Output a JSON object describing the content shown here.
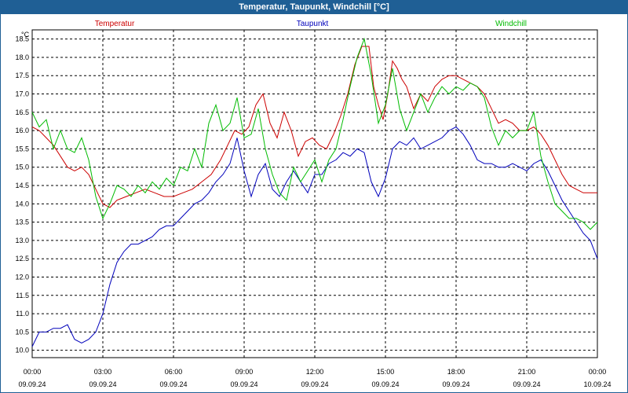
{
  "window": {
    "title": "Temperatur, Taupunkt, Windchill [°C]"
  },
  "chart_data": {
    "type": "line",
    "title": "Temperatur, Taupunkt, Windchill [°C]",
    "ylabel": "°C",
    "xlabel": "",
    "ylim": [
      9.8,
      18.75
    ],
    "xlim": [
      0,
      24
    ],
    "grid": true,
    "legend_position": "top",
    "y_ticks": [
      "10.0",
      "10.5",
      "11.0",
      "11.5",
      "12.0",
      "12.5",
      "13.0",
      "13.5",
      "14.0",
      "14.5",
      "15.0",
      "15.5",
      "16.0",
      "16.5",
      "17.0",
      "17.5",
      "18.0",
      "18.5"
    ],
    "x_ticks": [
      {
        "time": "00:00",
        "date": "09.09.24"
      },
      {
        "time": "03:00",
        "date": "09.09.24"
      },
      {
        "time": "06:00",
        "date": "09.09.24"
      },
      {
        "time": "09:00",
        "date": "09.09.24"
      },
      {
        "time": "12:00",
        "date": "09.09.24"
      },
      {
        "time": "15:00",
        "date": "09.09.24"
      },
      {
        "time": "18:00",
        "date": "09.09.24"
      },
      {
        "time": "21:00",
        "date": "09.09.24"
      },
      {
        "time": "00:00",
        "date": "10.09.24"
      }
    ],
    "series": [
      {
        "name": "Temperatur",
        "color": "#cc0000",
        "x": [
          0,
          0.3,
          0.6,
          0.9,
          1.2,
          1.5,
          1.8,
          2.1,
          2.4,
          2.7,
          3.0,
          3.3,
          3.6,
          4.0,
          4.4,
          4.8,
          5.2,
          5.6,
          6.0,
          6.4,
          6.8,
          7.2,
          7.6,
          8.0,
          8.3,
          8.6,
          8.9,
          9.2,
          9.5,
          9.8,
          10.1,
          10.4,
          10.7,
          11.0,
          11.3,
          11.6,
          11.9,
          12.2,
          12.5,
          12.8,
          13.1,
          13.4,
          13.7,
          14.0,
          14.3,
          14.5,
          14.7,
          14.9,
          15.1,
          15.3,
          15.5,
          15.7,
          15.9,
          16.2,
          16.5,
          16.8,
          17.1,
          17.4,
          17.7,
          18.0,
          18.3,
          18.6,
          18.9,
          19.2,
          19.5,
          19.8,
          20.1,
          20.4,
          20.7,
          21.0,
          21.3,
          21.6,
          21.9,
          22.2,
          22.5,
          22.8,
          23.1,
          23.4,
          23.7,
          24.0
        ],
        "values": [
          16.1,
          16.0,
          15.8,
          15.6,
          15.3,
          15.0,
          14.9,
          15.0,
          14.8,
          14.4,
          14.0,
          13.9,
          14.1,
          14.2,
          14.3,
          14.4,
          14.3,
          14.2,
          14.2,
          14.3,
          14.4,
          14.6,
          14.8,
          15.2,
          15.6,
          16.0,
          15.9,
          16.1,
          16.7,
          17.0,
          16.2,
          15.8,
          16.5,
          16.0,
          15.3,
          15.7,
          15.8,
          15.6,
          15.5,
          15.9,
          16.4,
          17.0,
          17.8,
          18.3,
          18.3,
          17.2,
          16.7,
          16.3,
          17.0,
          17.9,
          17.7,
          17.4,
          17.2,
          16.6,
          17.0,
          16.8,
          17.2,
          17.4,
          17.5,
          17.5,
          17.4,
          17.3,
          17.2,
          17.0,
          16.6,
          16.2,
          16.3,
          16.2,
          16.0,
          16.0,
          16.1,
          15.9,
          15.6,
          15.2,
          14.8,
          14.5,
          14.4,
          14.3,
          14.3,
          14.3
        ]
      },
      {
        "name": "Taupunkt",
        "color": "#0000bb",
        "x": [
          0,
          0.3,
          0.6,
          0.9,
          1.2,
          1.5,
          1.8,
          2.1,
          2.4,
          2.7,
          3.0,
          3.3,
          3.6,
          3.9,
          4.2,
          4.5,
          4.8,
          5.1,
          5.4,
          5.7,
          6.0,
          6.3,
          6.6,
          6.9,
          7.2,
          7.5,
          7.8,
          8.1,
          8.4,
          8.7,
          9.0,
          9.3,
          9.6,
          9.9,
          10.2,
          10.5,
          10.8,
          11.1,
          11.4,
          11.7,
          12.0,
          12.3,
          12.6,
          12.9,
          13.2,
          13.5,
          13.8,
          14.1,
          14.4,
          14.7,
          15.0,
          15.3,
          15.6,
          15.9,
          16.2,
          16.5,
          16.8,
          17.1,
          17.4,
          17.7,
          18.0,
          18.3,
          18.6,
          18.9,
          19.2,
          19.5,
          19.8,
          20.1,
          20.4,
          20.7,
          21.0,
          21.3,
          21.6,
          21.9,
          22.2,
          22.5,
          22.8,
          23.1,
          23.4,
          23.7,
          24.0
        ],
        "values": [
          10.1,
          10.5,
          10.5,
          10.6,
          10.6,
          10.7,
          10.3,
          10.2,
          10.3,
          10.5,
          11.0,
          11.8,
          12.4,
          12.7,
          12.9,
          12.9,
          13.0,
          13.1,
          13.3,
          13.4,
          13.4,
          13.6,
          13.8,
          14.0,
          14.1,
          14.3,
          14.6,
          14.8,
          15.1,
          15.8,
          14.9,
          14.2,
          14.8,
          15.1,
          14.4,
          14.2,
          14.6,
          14.9,
          14.6,
          14.3,
          14.8,
          14.8,
          15.1,
          15.2,
          15.4,
          15.3,
          15.5,
          15.4,
          14.6,
          14.2,
          14.7,
          15.5,
          15.7,
          15.6,
          15.8,
          15.5,
          15.6,
          15.7,
          15.8,
          16.0,
          16.1,
          15.9,
          15.6,
          15.2,
          15.1,
          15.1,
          15.0,
          15.0,
          15.1,
          15.0,
          14.9,
          15.1,
          15.2,
          14.9,
          14.5,
          14.1,
          13.8,
          13.5,
          13.2,
          13.0,
          12.5
        ]
      },
      {
        "name": "Windchill",
        "color": "#00bb00",
        "x": [
          0,
          0.3,
          0.6,
          0.9,
          1.2,
          1.5,
          1.8,
          2.1,
          2.4,
          2.7,
          3.0,
          3.3,
          3.6,
          3.9,
          4.2,
          4.5,
          4.8,
          5.1,
          5.4,
          5.7,
          6.0,
          6.3,
          6.6,
          6.9,
          7.2,
          7.5,
          7.8,
          8.1,
          8.4,
          8.7,
          9.0,
          9.3,
          9.6,
          9.9,
          10.2,
          10.5,
          10.8,
          11.1,
          11.4,
          11.7,
          12.0,
          12.3,
          12.6,
          12.9,
          13.2,
          13.5,
          13.8,
          14.1,
          14.4,
          14.7,
          15.0,
          15.3,
          15.6,
          15.9,
          16.2,
          16.5,
          16.8,
          17.1,
          17.4,
          17.7,
          18.0,
          18.3,
          18.6,
          18.9,
          19.2,
          19.5,
          19.8,
          20.1,
          20.4,
          20.7,
          21.0,
          21.3,
          21.6,
          21.9,
          22.2,
          22.5,
          22.8,
          23.1,
          23.4,
          23.7,
          24.0
        ],
        "values": [
          16.5,
          16.1,
          16.3,
          15.5,
          16.0,
          15.5,
          15.4,
          15.8,
          15.2,
          14.2,
          13.6,
          14.0,
          14.5,
          14.4,
          14.2,
          14.5,
          14.3,
          14.6,
          14.4,
          14.7,
          14.5,
          15.0,
          14.9,
          15.5,
          15.0,
          16.2,
          16.7,
          16.0,
          16.2,
          16.9,
          15.8,
          15.9,
          16.6,
          15.5,
          14.8,
          14.3,
          14.1,
          15.0,
          14.6,
          14.9,
          15.2,
          14.6,
          15.2,
          15.5,
          16.3,
          17.2,
          18.0,
          18.5,
          17.5,
          16.2,
          16.7,
          17.7,
          16.6,
          16.0,
          16.5,
          17.0,
          16.5,
          16.9,
          17.2,
          17.0,
          17.2,
          17.1,
          17.3,
          17.2,
          16.9,
          16.1,
          15.6,
          16.0,
          15.8,
          16.0,
          16.0,
          16.5,
          15.3,
          14.6,
          14.0,
          13.8,
          13.6,
          13.6,
          13.5,
          13.3,
          13.5
        ]
      }
    ]
  }
}
